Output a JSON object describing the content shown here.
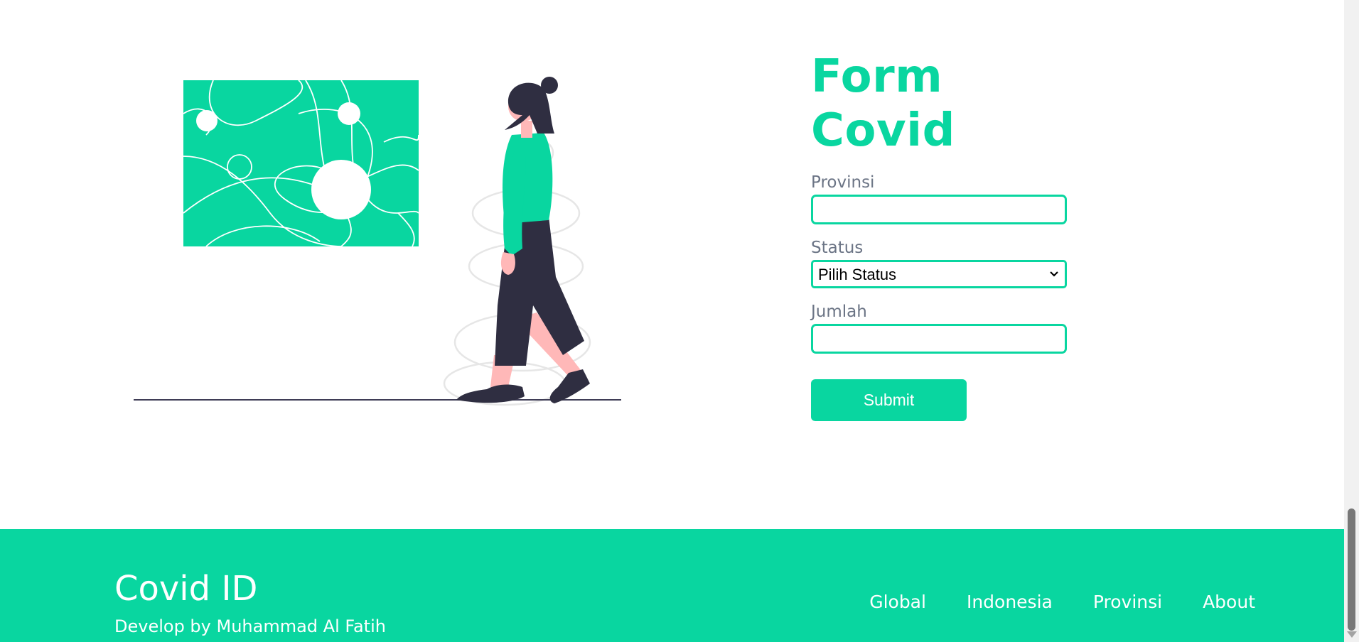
{
  "form": {
    "title": "Form Covid",
    "fields": [
      {
        "label": "Provinsi",
        "value": ""
      },
      {
        "label": "Status",
        "selected": "Pilih Status"
      },
      {
        "label": "Jumlah",
        "value": ""
      }
    ],
    "submit_label": "Submit"
  },
  "footer": {
    "brand": "Covid ID",
    "credit": "Develop by Muhammad Al Fatih",
    "nav": [
      "Global",
      "Indonesia",
      "Provinsi",
      "About"
    ]
  },
  "colors": {
    "accent": "#09d6a0",
    "label": "#6b7485",
    "figure_dark": "#2f2e41",
    "skin": "#ffb8b8"
  },
  "icons": {
    "select": "chevron-down-icon",
    "illustration": "woman-walking-art-gallery-illustration"
  }
}
